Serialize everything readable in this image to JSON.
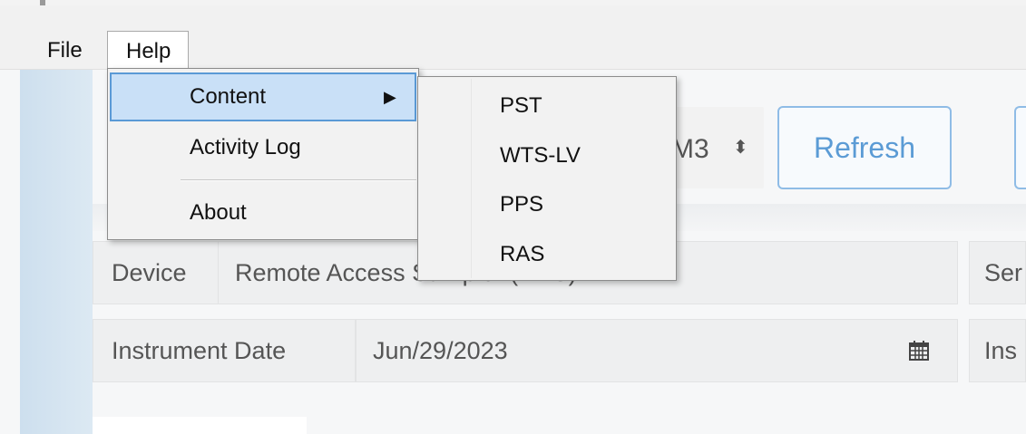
{
  "menubar": {
    "file_label": "File",
    "help_label": "Help"
  },
  "help_menu": {
    "items": [
      {
        "label": "Content",
        "has_submenu": true,
        "highlighted": true
      },
      {
        "label": "Activity Log"
      },
      {
        "label": "About"
      }
    ],
    "submenu_arrow": "▶"
  },
  "content_submenu": {
    "items": [
      "PST",
      "WTS-LV",
      "PPS",
      "RAS"
    ]
  },
  "toolbar": {
    "select_value_partial": "M3",
    "select_arrow": "⬍",
    "refresh_label": "Refresh"
  },
  "form": {
    "device_label": "Device",
    "device_value": "Remote Access Sampler    (RAS)",
    "serial_label_partial": "Ser",
    "instrument_date_label": "Instrument Date",
    "instrument_date_value": "Jun/29/2023",
    "instrument_partial_label": "Ins"
  },
  "icons": {
    "calendar": "calendar-icon",
    "submenu_arrow": "chevron-right-icon",
    "select_arrow": "updown-arrow-icon"
  },
  "colors": {
    "highlight_bg": "#c9e0f7",
    "highlight_border": "#5a9ad6",
    "button_text": "#5b9bd5"
  }
}
